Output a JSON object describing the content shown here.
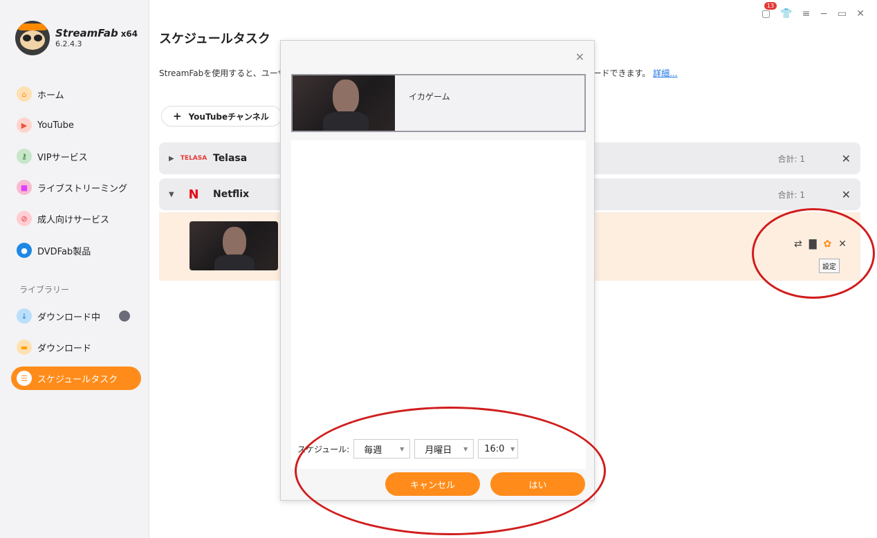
{
  "app": {
    "name": "StreamFab",
    "arch": "x64",
    "version": "6.2.4.3"
  },
  "window_controls": {
    "notification_count": "13"
  },
  "sidebar": {
    "items": [
      {
        "label": "ホーム",
        "icon": "home-icon",
        "color": "#ff8c1a"
      },
      {
        "label": "YouTube",
        "icon": "youtube-icon",
        "color": "#f0533a"
      },
      {
        "label": "VIPサービス",
        "icon": "key-icon",
        "color": "#4caf50"
      },
      {
        "label": "ライブストリーミング",
        "icon": "camera-icon",
        "color": "#e040fb"
      },
      {
        "label": "成人向けサービス",
        "icon": "adult-icon",
        "color": "#e53935"
      },
      {
        "label": "DVDFab製品",
        "icon": "dvdfab-icon",
        "color": "#1e88e5"
      }
    ],
    "library_label": "ライブラリー",
    "library": [
      {
        "label": "ダウンロード中",
        "icon": "download-arrow-icon",
        "color": "#1e88e5"
      },
      {
        "label": "ダウンロード",
        "icon": "folder-icon",
        "color": "#ffa000"
      },
      {
        "label": "スケジュールタスク",
        "icon": "schedule-icon",
        "color": "#ffffff"
      }
    ]
  },
  "main": {
    "title": "スケジュールタスク",
    "description": "StreamFabを使用すると、ユーザーがストリーミングサービスから毎日または毎週、新しい動画を自動的にダウンロードできます。",
    "description_link": "詳細...",
    "add_button": "YouTubeチャンネル",
    "services": [
      {
        "logo_text": "TELASA",
        "name": "Telasa",
        "total": "合計: 1"
      },
      {
        "logo_text": "N",
        "name": "Netflix",
        "total": "合計: 1"
      }
    ],
    "tooltip": "設定"
  },
  "modal": {
    "item_title": "イカゲーム",
    "schedule_label": "スケジュール:",
    "frequency": "毎週",
    "weekday": "月曜日",
    "time": "16:0",
    "cancel": "キャンセル",
    "ok": "はい"
  },
  "colors": {
    "accent": "#ff8c1a",
    "highlight_circle": "#d11c1c"
  }
}
